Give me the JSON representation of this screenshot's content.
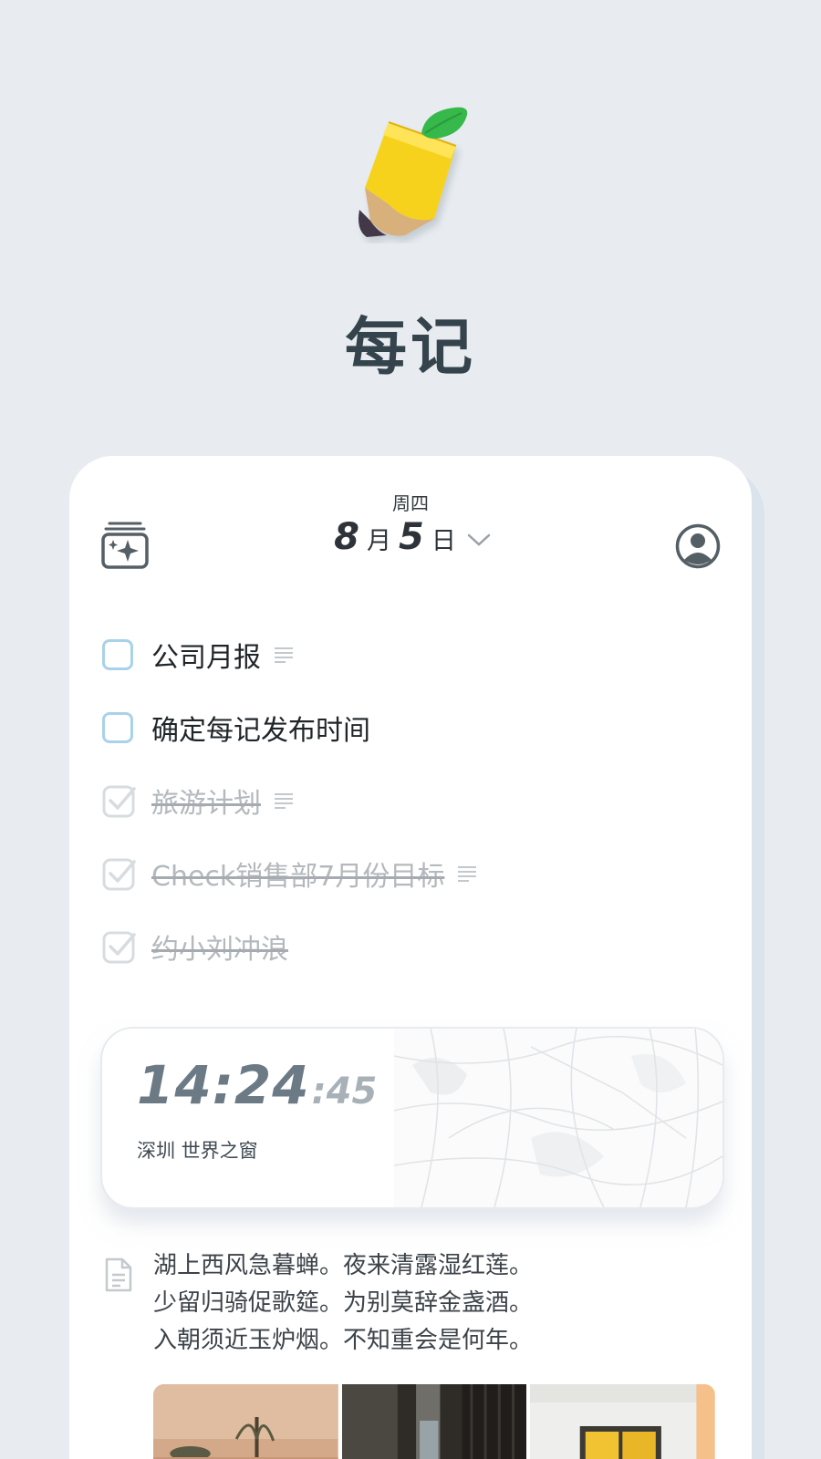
{
  "app": {
    "name": "每记",
    "logo_icon": "pencil-leaf-logo"
  },
  "header": {
    "weekday": "周四",
    "month": "8",
    "month_unit": "月",
    "day": "5",
    "day_unit": "日",
    "left_icon": "calendar-sparkle-icon",
    "right_icon": "user-profile-icon"
  },
  "tasks": [
    {
      "label": "公司月报",
      "done": false,
      "has_note": true
    },
    {
      "label": "确定每记发布时间",
      "done": false,
      "has_note": false
    },
    {
      "label": "旅游计划",
      "done": true,
      "has_note": true
    },
    {
      "label": "Check销售部7月份目标",
      "done": true,
      "has_note": true
    },
    {
      "label": "约小刘冲浪",
      "done": true,
      "has_note": false
    }
  ],
  "clock": {
    "hm": "14:24",
    "seconds": ":45",
    "location": "深圳 世界之窗"
  },
  "journal": {
    "lines": [
      "湖上西风急暮蝉。夜来清露湿红莲。",
      "少留归骑促歌筵。为别莫辞金盏酒。",
      "入朝须近玉炉烟。不知重会是何年。"
    ]
  },
  "colors": {
    "background": "#e8ecf0",
    "card": "#ffffff",
    "checkbox_border": "#a9d2ea",
    "title": "#34434c"
  }
}
